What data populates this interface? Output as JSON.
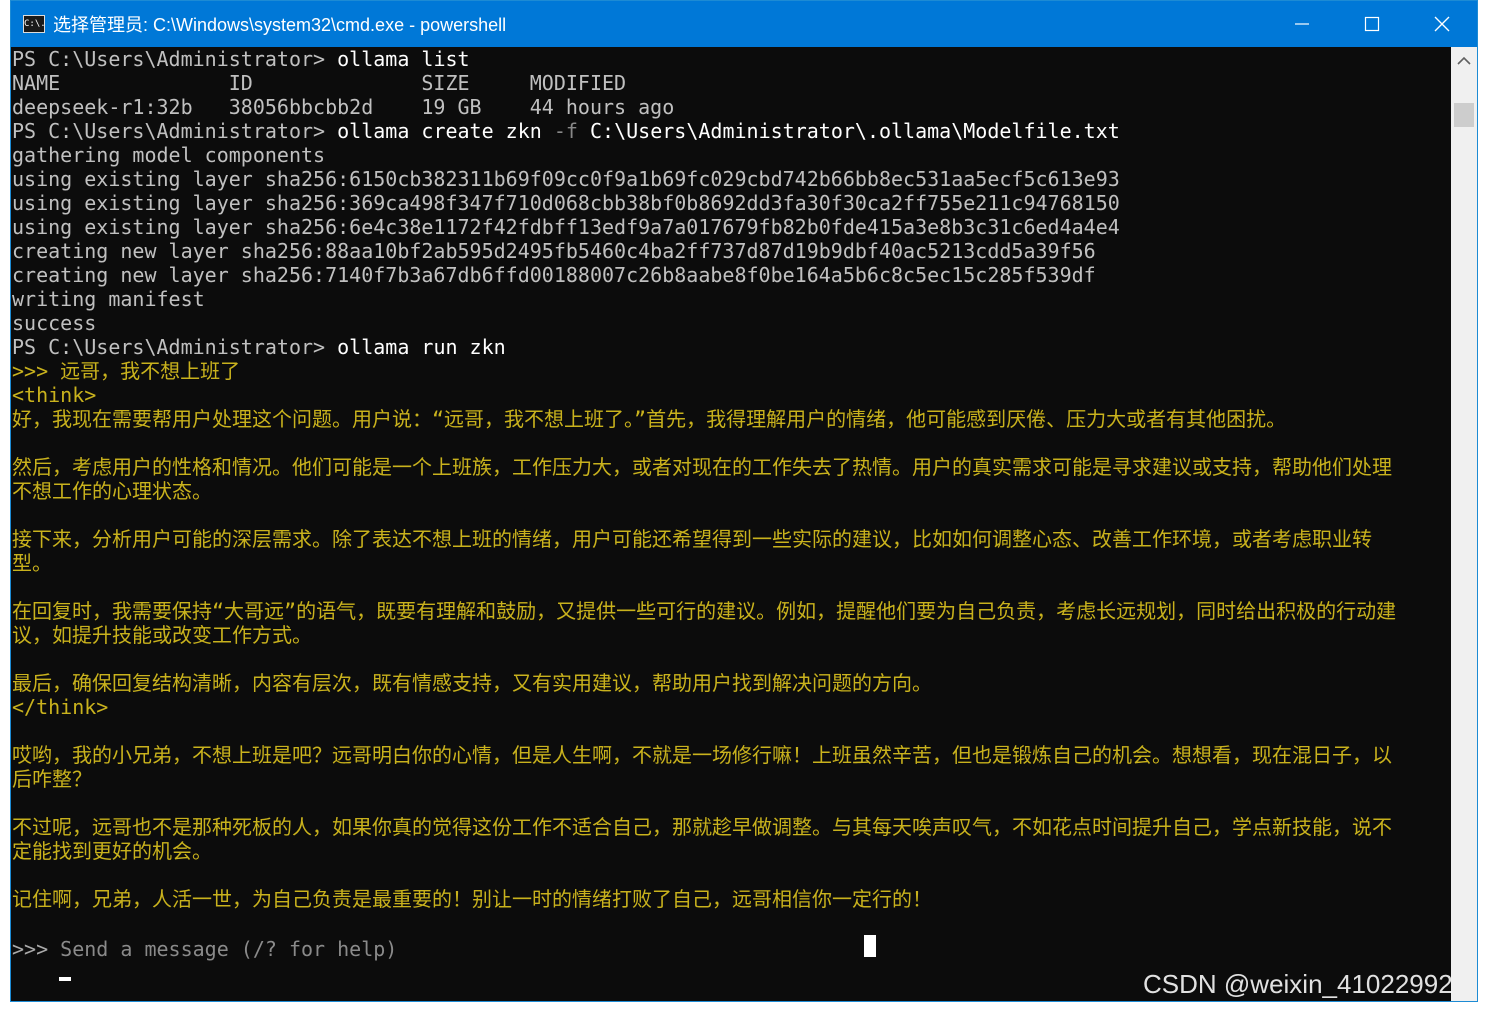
{
  "window": {
    "title": "选择管理员: C:\\Windows\\system32\\cmd.exe - powershell",
    "icon_label": "C:\\."
  },
  "console": {
    "lines": [
      {
        "prompt": "PS C:\\Users\\Administrator> ",
        "command": "ollama list"
      },
      {
        "text": "NAME              ID              SIZE     MODIFIED"
      },
      {
        "text": "deepseek-r1:32b   38056bbcbb2d    19 GB    44 hours ago"
      },
      {
        "prompt": "PS C:\\Users\\Administrator> ",
        "command": "ollama create zkn ",
        "flag": "-f",
        "command_rest": " C:\\Users\\Administrator\\.ollama\\Modelfile.txt"
      },
      {
        "text": "gathering model components"
      },
      {
        "text": "using existing layer sha256:6150cb382311b69f09cc0f9a1b69fc029cbd742b66bb8ec531aa5ecf5c613e93"
      },
      {
        "text": "using existing layer sha256:369ca498f347f710d068cbb38bf0b8692dd3fa30f30ca2ff755e211c94768150"
      },
      {
        "text": "using existing layer sha256:6e4c38e1172f42fdbff13edf9a7a017679fb82b0fde415a3e8b3c31c6ed4a4e4"
      },
      {
        "text": "creating new layer sha256:88aa10bf2ab595d2495fb5460c4ba2ff737d87d19b9dbf40ac5213cdd5a39f56"
      },
      {
        "text": "creating new layer sha256:7140f7b3a67db6ffd00188007c26b8aabe8f0be164a5b6c8c5ec15c285f539df"
      },
      {
        "text": "writing manifest"
      },
      {
        "text": "success"
      },
      {
        "prompt": "PS C:\\Users\\Administrator> ",
        "command": "ollama run zkn"
      }
    ],
    "chat_prompt": ">>> ",
    "chat_message": "远哥，我不想上班了",
    "think_open": "<think>",
    "think_paragraphs": [
      "好，我现在需要帮用户处理这个问题。用户说：“远哥，我不想上班了。”首先，我得理解用户的情绪，他可能感到厌倦、压力大或者有其他困扰。",
      "然后，考虑用户的性格和情况。他们可能是一个上班族，工作压力大，或者对现在的工作失去了热情。用户的真实需求可能是寻求建议或支持，帮助他们处理不想工作的心理状态。",
      "接下来，分析用户可能的深层需求。除了表达不想上班的情绪，用户可能还希望得到一些实际的建议，比如如何调整心态、改善工作环境，或者考虑职业转型。",
      "在回复时，我需要保持“大哥远”的语气，既要有理解和鼓励，又提供一些可行的建议。例如，提醒他们要为自己负责，考虑长远规划，同时给出积极的行动建议，如提升技能或改变工作方式。",
      "最后，确保回复结构清晰，内容有层次，既有情感支持，又有实用建议，帮助用户找到解决问题的方向。"
    ],
    "think_close": "</think>",
    "reply_paragraphs": [
      "哎哟，我的小兄弟，不想上班是吧？远哥明白你的心情，但是人生啊，不就是一场修行嘛！上班虽然辛苦，但也是锻炼自己的机会。想想看，现在混日子，以后咋整？",
      "不过呢，远哥也不是那种死板的人，如果你真的觉得这份工作不适合自己，那就趁早做调整。与其每天唉声叹气，不如花点时间提升自己，学点新技能，说不定能找到更好的机会。",
      "记住啊，兄弟，人活一世，为自己负责是最重要的！别让一时的情绪打败了自己，远哥相信你一定行的！"
    ],
    "input_prompt": ">>> ",
    "input_placeholder": "Send a message (/? for help)"
  },
  "watermark": "CSDN @weixin_41022992",
  "colors": {
    "titlebar": "#0078d7",
    "console_bg": "#0c0c0c",
    "console_text": "#c0c0c0",
    "model_text": "#c9b21d",
    "scrollbar": "#f0f0f0"
  },
  "icons": [
    "minimize-icon",
    "maximize-icon",
    "close-icon",
    "scroll-up-arrow-icon"
  ]
}
